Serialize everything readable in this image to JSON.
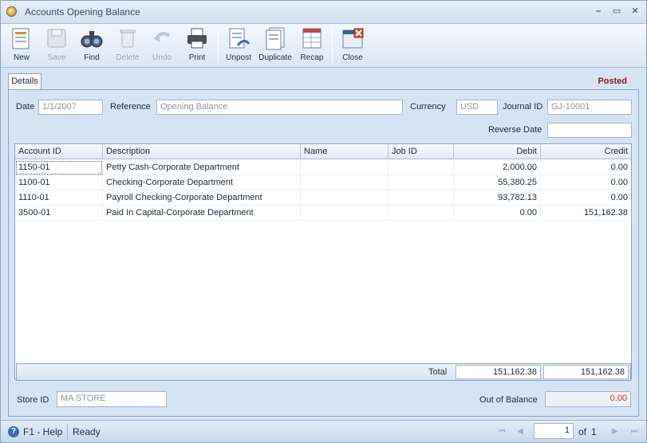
{
  "window": {
    "title": "Accounts Opening Balance"
  },
  "toolbar": {
    "new": "New",
    "save": "Save",
    "find": "Find",
    "delete": "Delete",
    "undo": "Undo",
    "print": "Print",
    "unpost": "Unpost",
    "duplicate": "Duplicate",
    "recap": "Recap",
    "close": "Close"
  },
  "tabs": {
    "details": "Details"
  },
  "status_badge": "Posted",
  "form": {
    "date_label": "Date",
    "date_value": "1/1/2007",
    "reference_label": "Reference",
    "reference_value": "Opening Balance",
    "currency_label": "Currency",
    "currency_value": "USD",
    "journal_label": "Journal ID",
    "journal_value": "GJ-10001",
    "reverse_label": "Reverse Date",
    "reverse_value": ""
  },
  "grid": {
    "columns": [
      "Account ID",
      "Description",
      "Name",
      "Job ID",
      "Debit",
      "Credit"
    ],
    "rows": [
      {
        "account": "1150-01",
        "description": "Petty Cash-Corporate Department",
        "name": "",
        "job": "",
        "debit": "2,000.00",
        "credit": "0.00"
      },
      {
        "account": "1100-01",
        "description": "Checking-Corporate Department",
        "name": "",
        "job": "",
        "debit": "55,380.25",
        "credit": "0.00"
      },
      {
        "account": "1110-01",
        "description": "Payroll Checking-Corporate Department",
        "name": "",
        "job": "",
        "debit": "93,782.13",
        "credit": "0.00"
      },
      {
        "account": "3500-01",
        "description": "Paid In Capital-Corporate Department",
        "name": "",
        "job": "",
        "debit": "0.00",
        "credit": "151,162.38"
      }
    ],
    "total_label": "Total",
    "total_debit": "151,162.38",
    "total_credit": "151,162.38"
  },
  "footer": {
    "store_label": "Store ID",
    "store_value": "MA STORE",
    "out_label": "Out of Balance",
    "out_value": "0.00"
  },
  "statusbar": {
    "help": "F1 - Help",
    "status": "Ready",
    "page": "1",
    "of_label": "of",
    "page_count": "1"
  }
}
